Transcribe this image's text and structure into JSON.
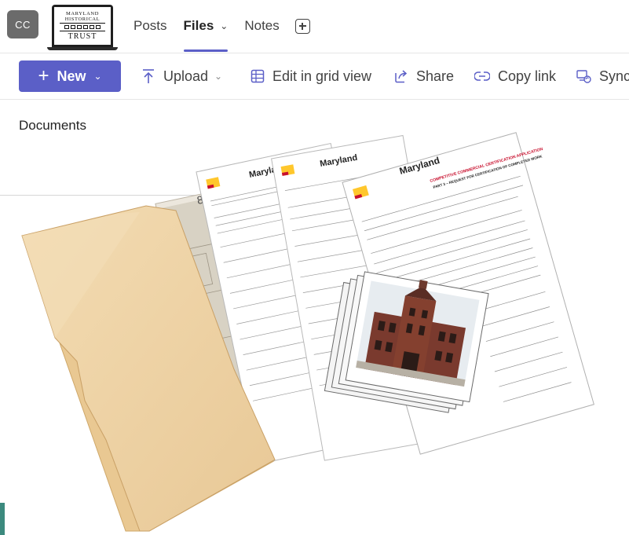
{
  "avatar": {
    "initials": "CC"
  },
  "team_logo": {
    "line1": "MARYLAND",
    "line2": "HISTORICAL",
    "line3": "TRUST"
  },
  "tabs": [
    {
      "label": "Posts",
      "active": false
    },
    {
      "label": "Files",
      "active": true,
      "has_dropdown": true
    },
    {
      "label": "Notes",
      "active": false
    }
  ],
  "toolbar": {
    "new_label": "New",
    "upload_label": "Upload",
    "grid_label": "Edit in grid view",
    "share_label": "Share",
    "copy_link_label": "Copy link",
    "sync_label": "Sync"
  },
  "library": {
    "title": "Documents"
  },
  "illustration": {
    "brand": "Maryland",
    "form_title_1": "COMPETITIVE COMMERCIAL CERTIFICATION APPLICATION",
    "form_title_2": "PART 3 – REQUEST FOR CERTIFICATION OF COMPLETED WORK",
    "map_number": "801"
  },
  "colors": {
    "accent": "#5b5fc7",
    "folder": "#f0d3a3",
    "form_red": "#c8102e",
    "md_yellow": "#ffc72c"
  }
}
